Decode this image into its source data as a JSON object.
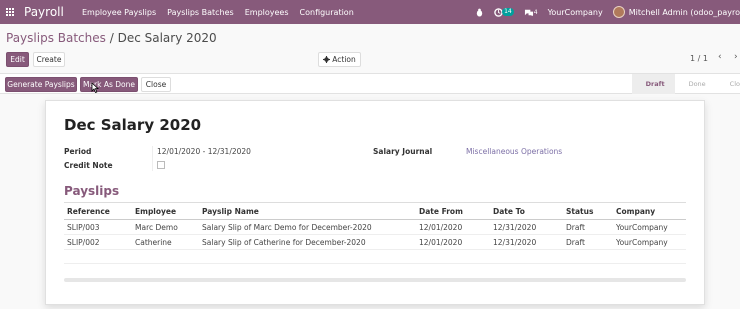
{
  "navbar": {
    "brand": "Payroll",
    "menu": [
      "Employee Payslips",
      "Payslips Batches",
      "Employees",
      "Configuration"
    ],
    "chat_badge": "14",
    "activity_badge": "4",
    "company": "YourCompany",
    "user": "Mitchell Admin (odoo_payro"
  },
  "breadcrumb": {
    "parent": "Payslips Batches",
    "separator": "/",
    "current": "Dec Salary 2020"
  },
  "buttons": {
    "edit": "Edit",
    "create": "Create",
    "action": "Action",
    "generate_payslips": "Generate Payslips",
    "mark_as_done": "Mark As Done",
    "close": "Close"
  },
  "pager": {
    "value": "1 / 1"
  },
  "status_steps": [
    "Draft",
    "Done",
    "Clo"
  ],
  "form": {
    "title": "Dec Salary 2020",
    "period_label": "Period",
    "period_value": "12/01/2020 - 12/31/2020",
    "credit_note_label": "Credit Note",
    "salary_journal_label": "Salary Journal",
    "salary_journal_value": "Miscellaneous Operations",
    "section_title": "Payslips"
  },
  "table": {
    "columns": [
      "Reference",
      "Employee",
      "Payslip Name",
      "Date From",
      "Date To",
      "Status",
      "Company"
    ],
    "rows": [
      [
        "SLIP/003",
        "Marc Demo",
        "Salary Slip of Marc Demo for December-2020",
        "12/01/2020",
        "12/31/2020",
        "Draft",
        "YourCompany"
      ],
      [
        "SLIP/002",
        "Catherine",
        "Salary Slip of Catherine for December-2020",
        "12/01/2020",
        "12/31/2020",
        "Draft",
        "YourCompany"
      ]
    ]
  },
  "colors": {
    "brand": "#875a7b",
    "link": "#7c6fa6",
    "badge": "#00a09d"
  }
}
